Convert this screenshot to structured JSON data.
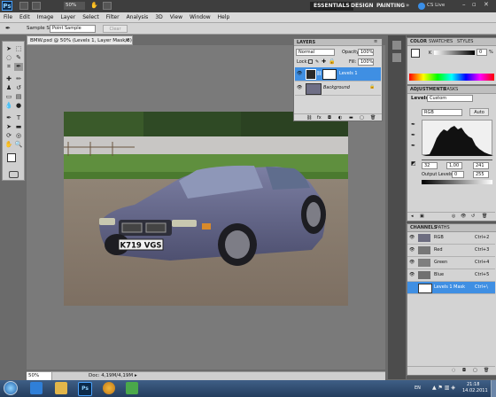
{
  "app": {
    "logo": "Ps",
    "zoom": "50%",
    "workspaces": [
      "ESSENTIALS",
      "DESIGN",
      "PAINTING"
    ],
    "cs_live": "CS Live"
  },
  "menu": [
    "File",
    "Edit",
    "Image",
    "Layer",
    "Select",
    "Filter",
    "Analysis",
    "3D",
    "View",
    "Window",
    "Help"
  ],
  "options": {
    "sample_size_label": "Sample Size:",
    "sample_size_value": "Point Sample",
    "clear_button": "Clear"
  },
  "document": {
    "tab_title": "BMW.psd @ 50% (Levels 1, Layer Mask/8)",
    "status_zoom": "50%",
    "status_doc": "Doc: 4,19M/4,19M",
    "plate_text": "K719 VGS"
  },
  "layers_panel": {
    "tab": "LAYERS",
    "blend_mode": "Normal",
    "opacity_label": "Opacity:",
    "opacity_value": "100%",
    "lock_label": "Lock:",
    "fill_label": "Fill:",
    "fill_value": "100%",
    "layers": [
      {
        "name": "Levels 1"
      },
      {
        "name": "Background"
      }
    ]
  },
  "color_panel": {
    "tabs": [
      "COLOR",
      "SWATCHES",
      "STYLES"
    ],
    "k_label": "K",
    "k_value": "0",
    "k_unit": "%"
  },
  "adjustments_panel": {
    "tabs": [
      "ADJUSTMENTS",
      "MASKS"
    ],
    "title": "Levels",
    "preset": "Custom",
    "channel": "RGB",
    "auto_button": "Auto",
    "input_black": "32",
    "input_gamma": "1,00",
    "input_white": "241",
    "output_label": "Output Levels:",
    "output_black": "0",
    "output_white": "255"
  },
  "channels_panel": {
    "tabs": [
      "CHANNELS",
      "PATHS"
    ],
    "channels": [
      {
        "name": "RGB",
        "shortcut": "Ctrl+2"
      },
      {
        "name": "Red",
        "shortcut": "Ctrl+3"
      },
      {
        "name": "Green",
        "shortcut": "Ctrl+4"
      },
      {
        "name": "Blue",
        "shortcut": "Ctrl+5"
      },
      {
        "name": "Levels 1 Mask",
        "shortcut": "Ctrl+\\"
      }
    ]
  },
  "taskbar": {
    "language": "EN",
    "time": "21:18",
    "date": "14.02.2011",
    "ps_label": "Ps"
  },
  "colors": {
    "accent": "#3d8fe0",
    "selected_row": "#3f8fe3",
    "app_bar": "#3e3e3e"
  }
}
